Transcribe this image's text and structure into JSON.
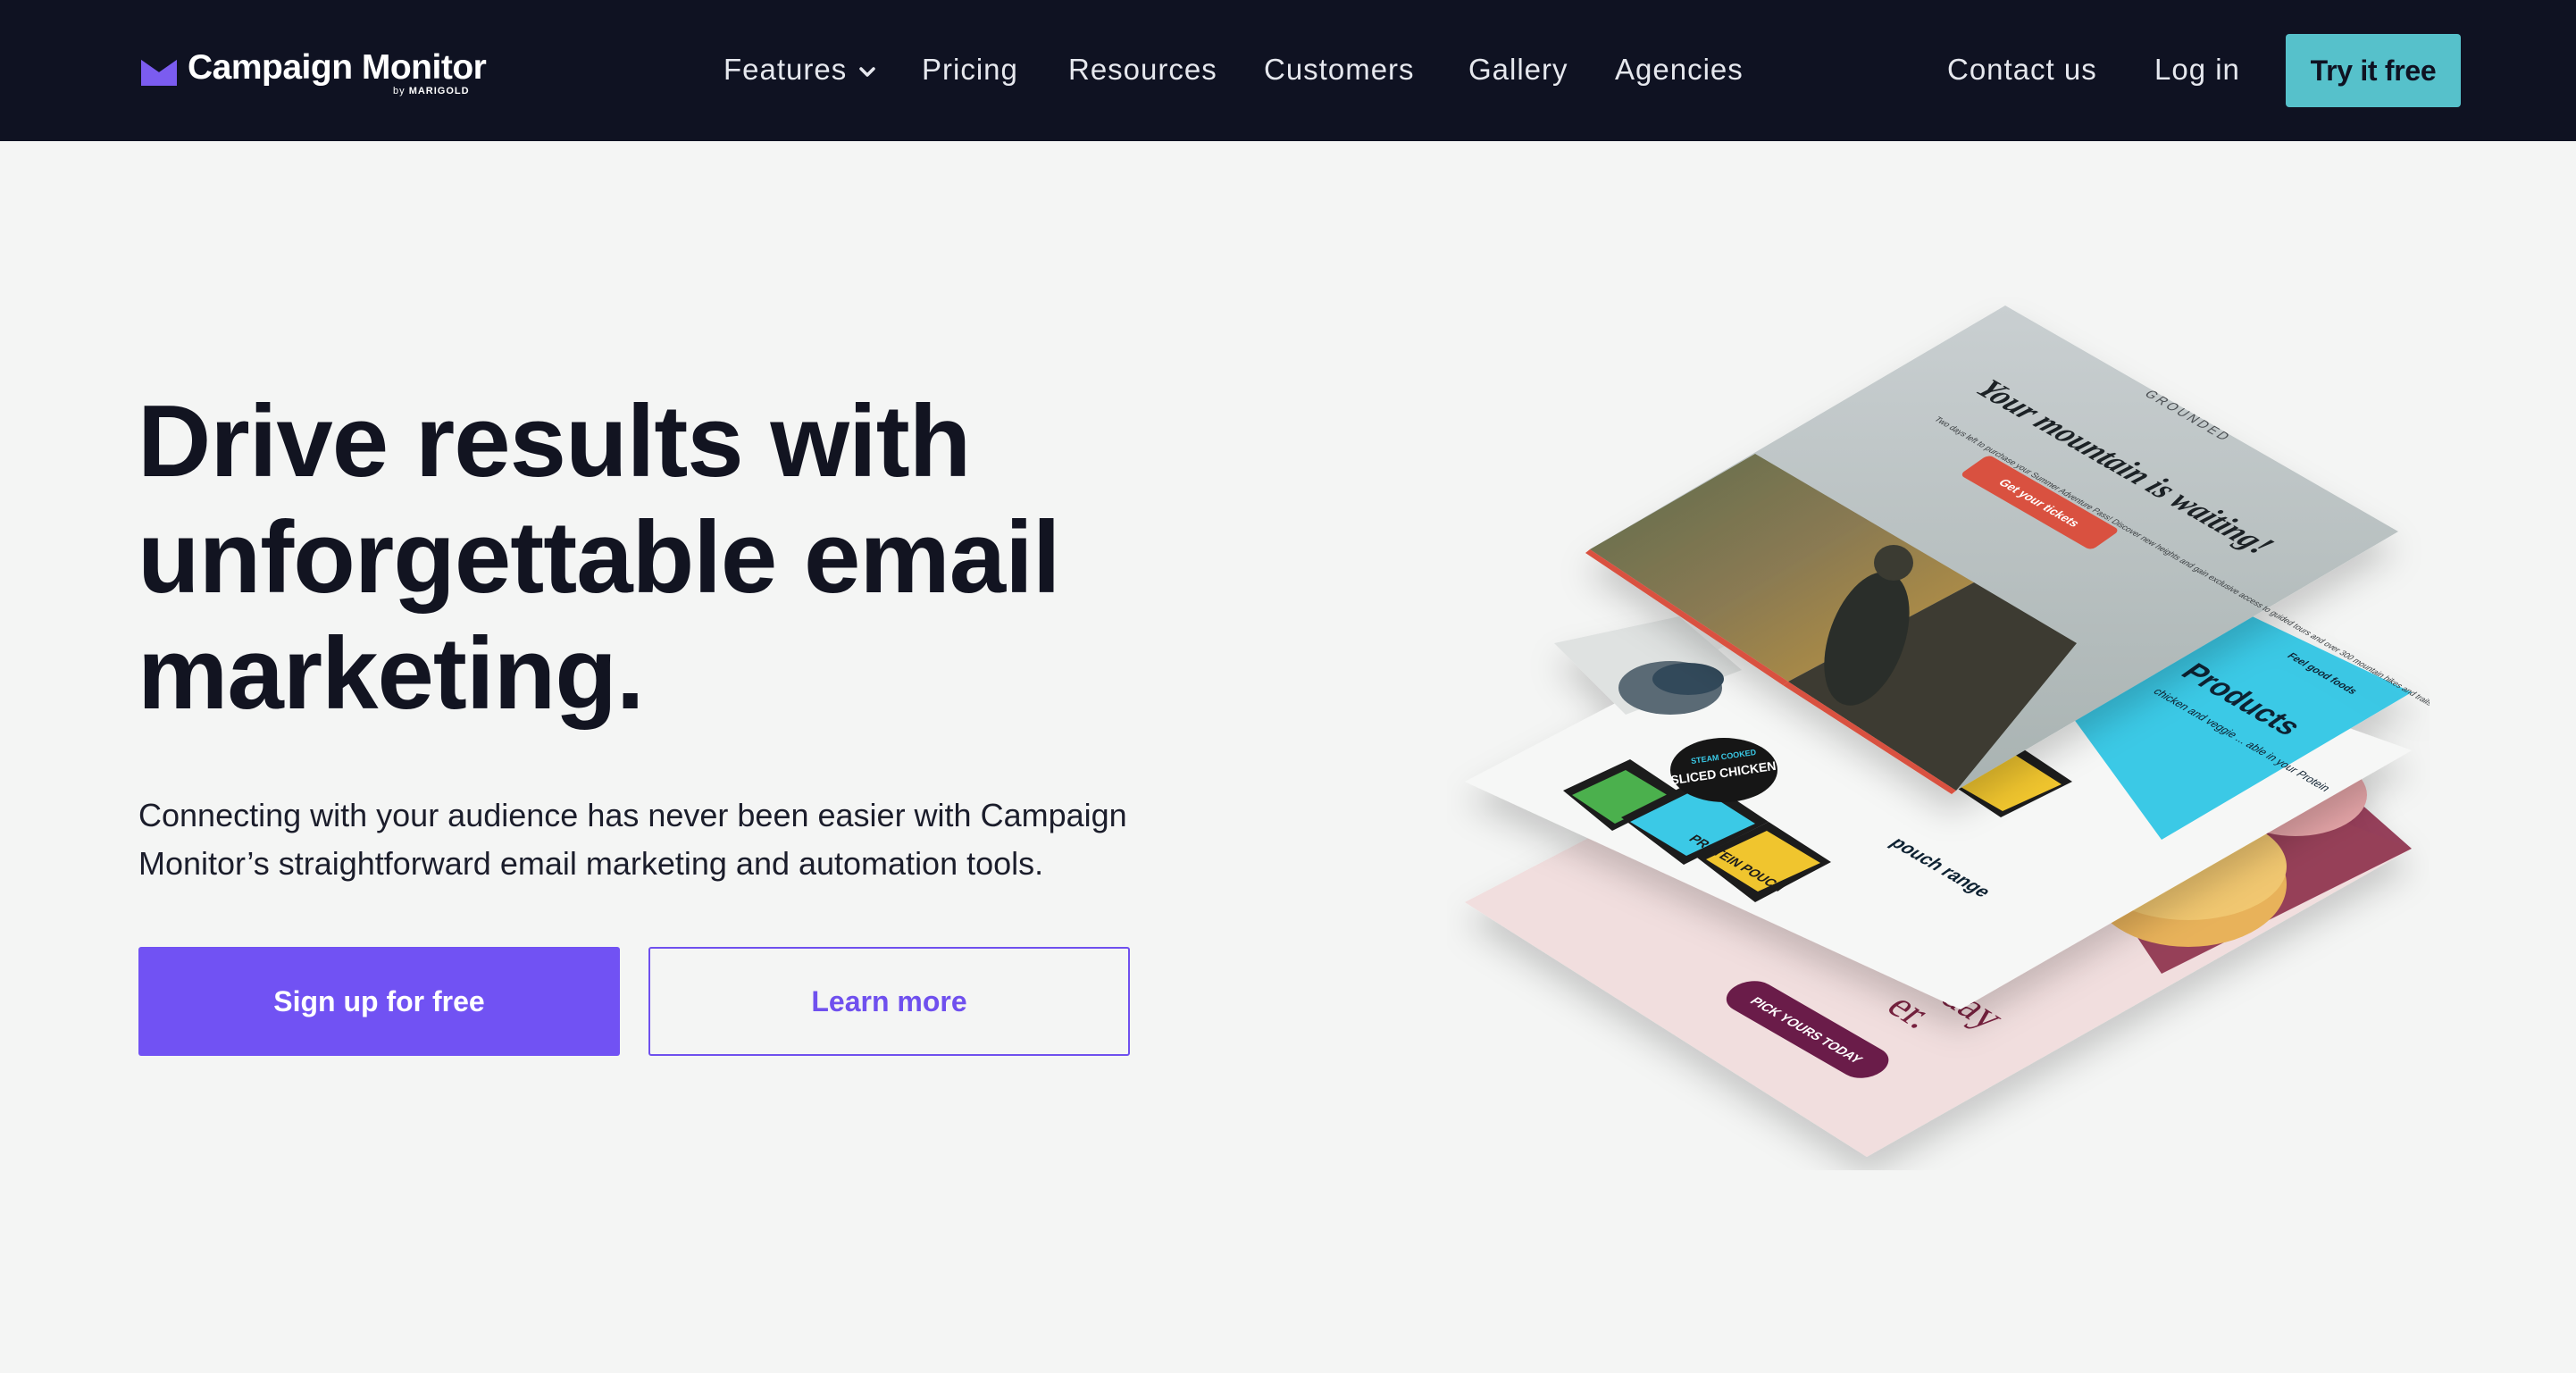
{
  "header": {
    "logo": {
      "name": "Campaign Monitor",
      "by": "by",
      "parent": "MARIGOLD",
      "icon": "envelope-icon"
    },
    "nav": {
      "features": "Features",
      "features_icon": "chevron-down-icon",
      "pricing": "Pricing",
      "resources": "Resources",
      "customers": "Customers",
      "gallery": "Gallery",
      "agencies": "Agencies",
      "contact": "Contact us",
      "login": "Log in"
    },
    "cta": "Try it free"
  },
  "hero": {
    "title": "Drive results with unforgettable email marketing.",
    "subtitle": "Connecting with your audience has never been easier with Campaign Monitor’s straightforward email marketing and automation tools.",
    "primary_button": "Sign up for free",
    "secondary_button": "Learn more"
  },
  "illustration": {
    "top_card": {
      "brand": "GROUNDED",
      "headline": "Your mountain is waiting!",
      "body": "Two days left to purchase your Summer Adventure Pass! Discover new heights and gain exclusive access to guided tours and over 300 mountain hikes and trails.",
      "button": "Get your tickets"
    },
    "middle_card": {
      "tag": "Feel good foods",
      "heading": "Products",
      "body": "chicken and veggie ... able in your Protein",
      "range": "pouch range",
      "pack_1_badge": "STEAM COOKED",
      "pack_1_label": "SLICED CHICKEN",
      "pack_2_label": "PROTEIN POUCH"
    },
    "bottom_card": {
      "headline_fragment": "day",
      "headline_fragment_2": "er.",
      "button": "PICK YOURS TODAY"
    }
  },
  "colors": {
    "header_bg": "#0f1222",
    "page_bg": "#f4f5f4",
    "accent_purple": "#7152f3",
    "accent_teal": "#56c1cb",
    "logo_purple": "#7b5cf0",
    "card_cyan": "#3ac9e6",
    "card_pink": "#f1dede",
    "ticket_red": "#d9513f"
  }
}
